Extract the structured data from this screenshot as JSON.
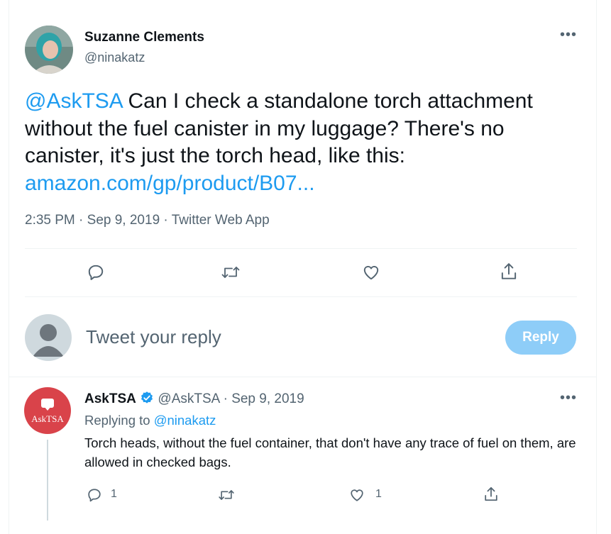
{
  "tweet": {
    "author_name": "Suzanne Clements",
    "author_handle": "@ninakatz",
    "more_label": "•••",
    "mention": "@AskTSA",
    "text": " Can I check a standalone torch attachment without the fuel canister in my luggage? There's no canister, it's just the torch head, like this: ",
    "link": "amazon.com/gp/product/B07...",
    "time": "2:35 PM",
    "date": "Sep 9, 2019",
    "source": "Twitter Web App",
    "sep": "·"
  },
  "composer": {
    "placeholder": "Tweet your reply",
    "reply_label": "Reply"
  },
  "reply": {
    "author_name": "AskTSA",
    "author_handle": "@AskTSA",
    "date": "Sep 9, 2019",
    "sep": "·",
    "avatar_text": "AskTSA",
    "replying_prefix": "Replying to ",
    "replying_handle": "@ninakatz",
    "text": "Torch heads, without the fuel container, that don't have any trace of fuel on them, are allowed in checked bags.",
    "reply_count": "1",
    "like_count": "1",
    "more_label": "•••"
  },
  "icons": [
    "reply-icon",
    "retweet-icon",
    "like-icon",
    "share-icon",
    "verified-badge-icon",
    "more-icon"
  ],
  "colors": {
    "accent": "#1d9bf0",
    "reply_button_disabled": "#8ecdf8",
    "asktsa_brand": "#d9434a",
    "muted_text": "#536471"
  }
}
